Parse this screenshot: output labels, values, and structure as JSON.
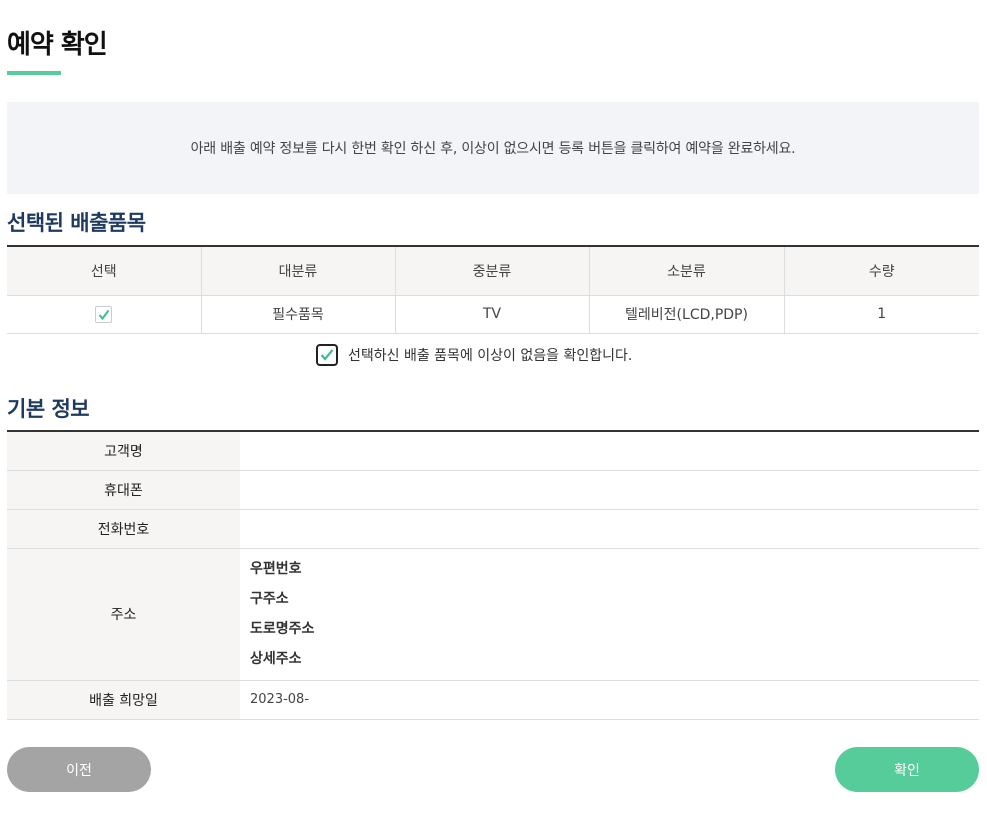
{
  "page": {
    "title": "예약 확인"
  },
  "notice": {
    "text": "아래 배출 예약 정보를 다시 한번 확인 하신 후, 이상이 없으시면 등록 버튼을 클릭하여 예약을 완료하세요."
  },
  "items_section": {
    "title": "선택된 배출품목",
    "headers": [
      "선택",
      "대분류",
      "중분류",
      "소분류",
      "수량"
    ],
    "rows": [
      {
        "checked": true,
        "major": "필수품목",
        "middle": "TV",
        "minor": "텔레비전(LCD,PDP)",
        "qty": "1"
      }
    ]
  },
  "confirm": {
    "checked": true,
    "label": "선택하신 배출 품목에 이상이 없음을 확인합니다."
  },
  "basic_section": {
    "title": "기본 정보",
    "customer_label": "고객명",
    "customer_value": "",
    "mobile_label": "휴대폰",
    "mobile_value": "",
    "phone_label": "전화번호",
    "phone_value": "",
    "address_label": "주소",
    "address_lines": [
      "우편번호",
      "구주소",
      "도로명주소",
      "상세주소"
    ],
    "date_label": "배출 희망일",
    "date_value": "2023-08-"
  },
  "buttons": {
    "prev": "이전",
    "ok": "확인"
  },
  "colors": {
    "accent": "#55cc9a",
    "navy": "#1e3a5f",
    "gray_button": "#a4a4a4"
  }
}
